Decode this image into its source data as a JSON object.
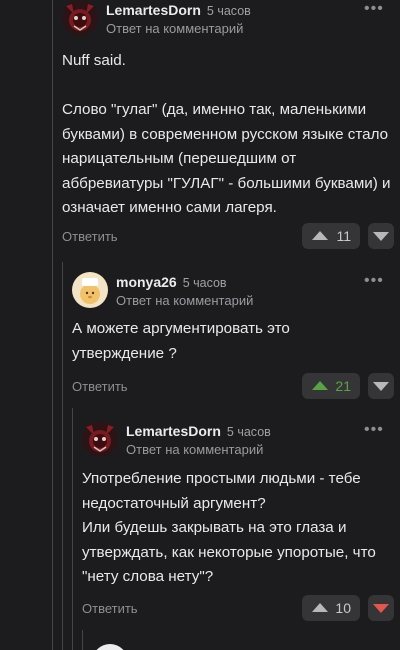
{
  "colors": {
    "background": "#1c1c1e",
    "upvoted": "#5aa344",
    "downvoted": "#e2574c",
    "neutral_arrow": "#b8b8bc"
  },
  "comments": [
    {
      "author": "LemartesDorn",
      "time": "5 часов",
      "reply_to": "Ответ на комментарий",
      "more_icon": "more-dots-icon",
      "text": "Nuff said.\n\nСлово \"гулаг\" (да, именно так, маленькими буквами) в современном русском языке стало нарицательным (перешедшим от аббревиатуры \"ГУЛАГ\" - большими буквами) и означает именно сами лагеря.",
      "reply_label": "Ответить",
      "rating": "11",
      "vote_state": "none"
    },
    {
      "author": "monya26",
      "time": "5 часов",
      "reply_to": "Ответ на комментарий",
      "more_icon": "more-dots-icon",
      "text": "А можете аргументировать это утверждение ?",
      "reply_label": "Ответить",
      "rating": "21",
      "vote_state": "up"
    },
    {
      "author": "LemartesDorn",
      "time": "5 часов",
      "reply_to": "Ответ на комментарий",
      "more_icon": "more-dots-icon",
      "text": "Употребление простыми людьми - тебе недостаточный аргумент?\nИли будешь закрывать на это глаза и утверждать, как некоторые упоротые, что \"нету слова нету\"?",
      "reply_label": "Ответить",
      "rating": "10",
      "vote_state": "down"
    }
  ]
}
